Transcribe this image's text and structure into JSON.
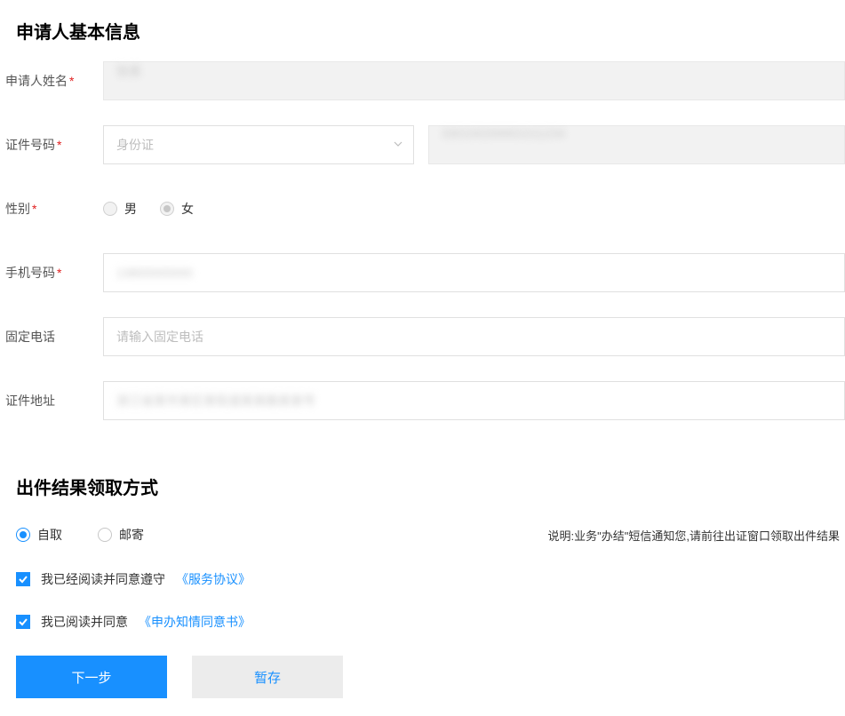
{
  "section1": {
    "title": "申请人基本信息"
  },
  "section2": {
    "title": "出件结果领取方式"
  },
  "fields": {
    "name_label": "申请人姓名",
    "name_value": "张某",
    "idtype_label": "证件号码",
    "idtype_selected": "身份证",
    "idnum_value": "330100200001011234",
    "gender_label": "性别",
    "gender_male": "男",
    "gender_female": "女",
    "mobile_label": "手机号码",
    "mobile_value": "13800000000",
    "landline_label": "固定电话",
    "landline_placeholder": "请输入固定电话",
    "address_label": "证件地址",
    "address_value": "浙江省某市某区某街道某某路某某号"
  },
  "delivery": {
    "pickup": "自取",
    "mail": "邮寄",
    "note": "说明:业务\"办结\"短信通知您,请前往出证窗口领取出件结果"
  },
  "agreements": {
    "line1_text": "我已经阅读并同意遵守",
    "line1_link": "《服务协议》",
    "line2_text": "我已阅读并同意",
    "line2_link": "《申办知情同意书》"
  },
  "buttons": {
    "next": "下一步",
    "save": "暂存"
  }
}
